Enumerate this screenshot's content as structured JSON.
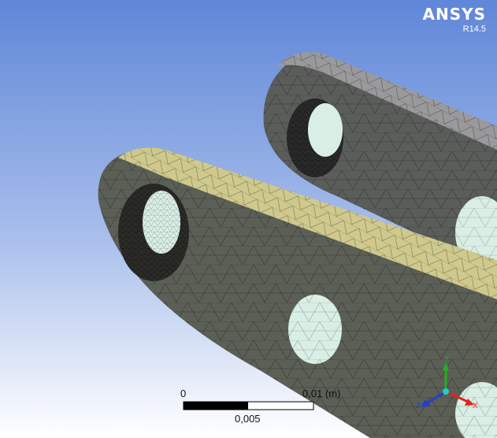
{
  "branding": {
    "logo": "ANSYS",
    "release": "R14.5"
  },
  "scale_bar": {
    "label_start": "0",
    "label_end": "0,01 (m)",
    "label_mid": "0,005"
  },
  "triad": {
    "x_label": "X",
    "y_label": "Y",
    "z_label": "Z"
  },
  "colors": {
    "background_top": "#5f86d8",
    "background_bottom": "#ffffff",
    "front_link_face": "#cfc98d",
    "front_link_side": "#5b5f55",
    "back_link_face": "#9a9a9c",
    "back_link_side": "#5a5d5a",
    "hole_fill": "#d9eee4",
    "x_axis": "#e02020",
    "y_axis": "#20b020",
    "z_axis": "#2040d0"
  }
}
